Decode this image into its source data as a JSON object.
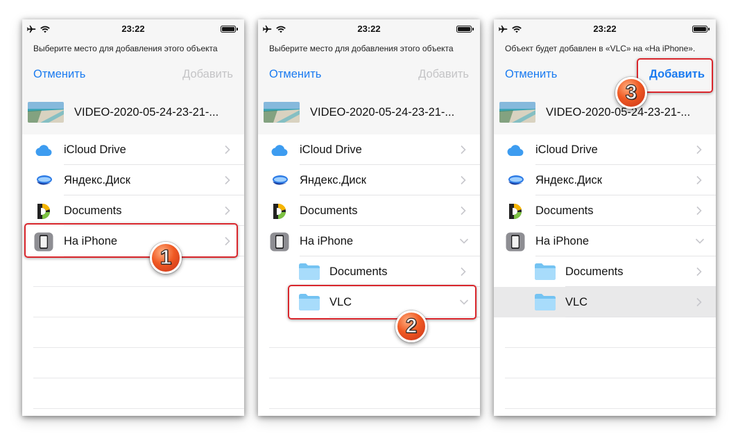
{
  "status_bar": {
    "time": "23:22"
  },
  "screens": [
    {
      "prompt": "Выберите место для добавления этого объекта",
      "cancel_label": "Отменить",
      "add_label": "Добавить",
      "file_name": "VIDEO-2020-05-24-23-21-...",
      "locations": [
        {
          "label": "iCloud Drive",
          "icon": "icloud-icon"
        },
        {
          "label": "Яндекс.Диск",
          "icon": "yandex-disk-icon"
        },
        {
          "label": "Documents",
          "icon": "documents-app-icon"
        },
        {
          "label": "На iPhone",
          "icon": "iphone-icon"
        }
      ],
      "step_number": "1"
    },
    {
      "prompt": "Выберите место для добавления этого объекта",
      "cancel_label": "Отменить",
      "add_label": "Добавить",
      "file_name": "VIDEO-2020-05-24-23-21-...",
      "locations": [
        {
          "label": "iCloud Drive",
          "icon": "icloud-icon"
        },
        {
          "label": "Яндекс.Диск",
          "icon": "yandex-disk-icon"
        },
        {
          "label": "Documents",
          "icon": "documents-app-icon"
        },
        {
          "label": "На iPhone",
          "icon": "iphone-icon"
        }
      ],
      "folders": [
        {
          "label": "Documents",
          "icon": "folder-icon"
        },
        {
          "label": "VLC",
          "icon": "folder-icon"
        }
      ],
      "step_number": "2"
    },
    {
      "prompt": "Объект будет добавлен в «VLC» на «На iPhone».",
      "cancel_label": "Отменить",
      "add_label": "Добавить",
      "file_name": "VIDEO-2020-05-24-23-21-...",
      "locations": [
        {
          "label": "iCloud Drive",
          "icon": "icloud-icon"
        },
        {
          "label": "Яндекс.Диск",
          "icon": "yandex-disk-icon"
        },
        {
          "label": "Documents",
          "icon": "documents-app-icon"
        },
        {
          "label": "На iPhone",
          "icon": "iphone-icon"
        }
      ],
      "folders": [
        {
          "label": "Documents",
          "icon": "folder-icon"
        },
        {
          "label": "VLC",
          "icon": "folder-icon"
        }
      ],
      "step_number": "3"
    }
  ],
  "colors": {
    "ios_blue": "#1a7bf0",
    "disabled_gray": "#c4c4c6",
    "highlight_red": "#d9262c",
    "badge_orange": "#f05a23",
    "folder_blue": "#8fd0f7"
  }
}
